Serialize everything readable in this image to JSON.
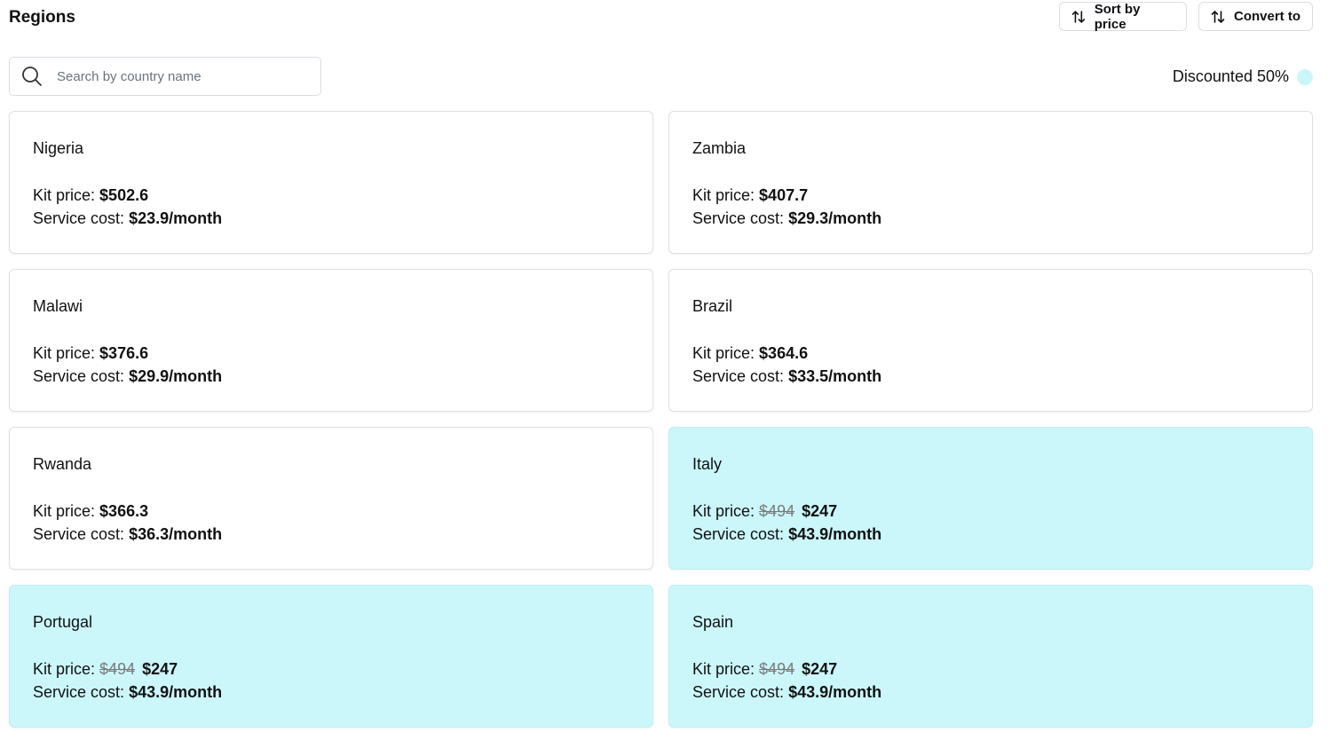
{
  "header": {
    "title": "Regions",
    "sort_label": "Sort by price",
    "convert_label": "Convert to"
  },
  "search": {
    "placeholder": "Search by country name",
    "value": ""
  },
  "legend": {
    "label": "Discounted 50%",
    "color": "#cbf7fb"
  },
  "labels": {
    "kit": "Kit price:",
    "service": "Service cost:"
  },
  "regions": [
    {
      "name": "Nigeria",
      "kit_price": "$502.6",
      "service_cost": "$23.9/month",
      "discounted": false
    },
    {
      "name": "Zambia",
      "kit_price": "$407.7",
      "service_cost": "$29.3/month",
      "discounted": false
    },
    {
      "name": "Malawi",
      "kit_price": "$376.6",
      "service_cost": "$29.9/month",
      "discounted": false
    },
    {
      "name": "Brazil",
      "kit_price": "$364.6",
      "service_cost": "$33.5/month",
      "discounted": false
    },
    {
      "name": "Rwanda",
      "kit_price": "$366.3",
      "service_cost": "$36.3/month",
      "discounted": false
    },
    {
      "name": "Italy",
      "original_price": "$494",
      "kit_price": "$247",
      "service_cost": "$43.9/month",
      "discounted": true
    },
    {
      "name": "Portugal",
      "original_price": "$494",
      "kit_price": "$247",
      "service_cost": "$43.9/month",
      "discounted": true
    },
    {
      "name": "Spain",
      "original_price": "$494",
      "kit_price": "$247",
      "service_cost": "$43.9/month",
      "discounted": true
    }
  ],
  "colors": {
    "discount_bg": "#cbf7fb",
    "border": "#dde1e5"
  }
}
